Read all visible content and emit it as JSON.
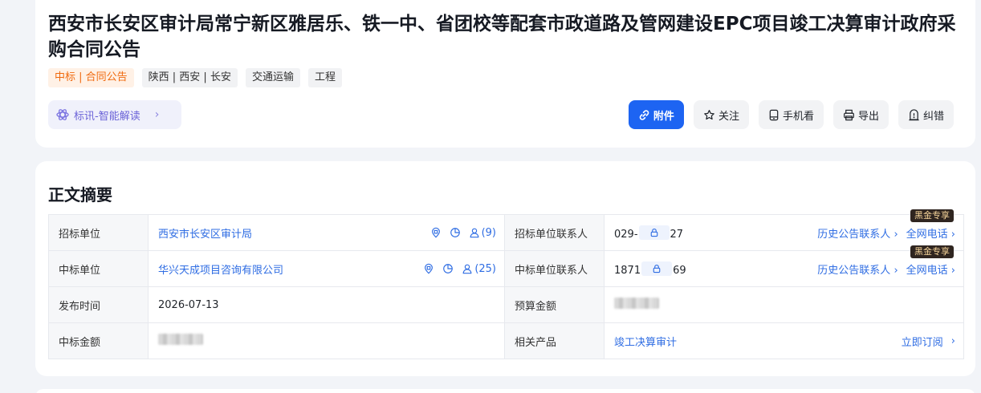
{
  "notice": {
    "title": "西安市长安区审计局常宁新区雅居乐、铁一中、省团校等配套市政道路及管网建设EPC项目竣工决算审计政府采购合同公告",
    "tags": [
      "中标 | 合同公告",
      "陕西 | 西安 | 长安",
      "交通运输",
      "工程"
    ]
  },
  "ai_button": {
    "label": "标讯-智能解读"
  },
  "actions": {
    "attachment": "附件",
    "follow": "关注",
    "mobile": "手机看",
    "export": "导出",
    "correct": "纠错"
  },
  "summary": {
    "title": "正文摘要",
    "rows": [
      {
        "left_label": "招标单位",
        "left_value": "西安市长安区审计局",
        "left_count": "(9)",
        "right_label": "招标单位联系人",
        "phone_prefix": "029-",
        "phone_suffix": "27",
        "history_link": "历史公告联系人",
        "all_phone_link": "全网电话",
        "badge": "黑金专享"
      },
      {
        "left_label": "中标单位",
        "left_value": "华兴天成项目咨询有限公司",
        "left_count": "(25)",
        "right_label": "中标单位联系人",
        "phone_prefix": "1871",
        "phone_suffix": "69",
        "history_link": "历史公告联系人",
        "all_phone_link": "全网电话",
        "badge": "黑金专享"
      },
      {
        "left_label": "发布时间",
        "left_value": "2026-07-13",
        "right_label": "预算金额"
      },
      {
        "left_label": "中标金额",
        "right_label": "相关产品",
        "product": "竣工决算审计",
        "subscribe_link": "立即订阅"
      }
    ]
  },
  "colors": {
    "primary": "#1d64f2",
    "link": "#2f6de3",
    "tag_orange": "#f06a0f",
    "ai_purple": "#6b63d8",
    "vip_bg": "#2f2520",
    "vip_text": "#f6d49a"
  },
  "icons": [
    "sparkle-icon",
    "chevron-right-icon",
    "link-icon",
    "star-icon",
    "phone-icon",
    "printer-icon",
    "report-icon",
    "building-icon",
    "chart-icon",
    "user-icon",
    "lock-icon"
  ]
}
